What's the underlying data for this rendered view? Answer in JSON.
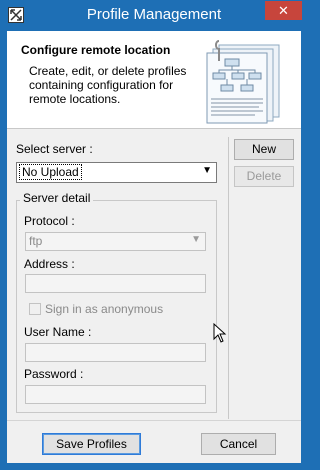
{
  "window": {
    "title": "Profile Management",
    "app_icon": "resize-arrows-icon",
    "close_icon": "close-icon"
  },
  "banner": {
    "title": "Configure remote location",
    "description": "Create, edit, or delete profiles containing configuration for remote locations.",
    "illustration": "document-flowchart-icon"
  },
  "server": {
    "label": "Select server :",
    "selected": "No Upload",
    "new_label": "New",
    "delete_label": "Delete"
  },
  "detail": {
    "group_label": "Server detail",
    "protocol_label": "Protocol :",
    "protocol_value": "ftp",
    "address_label": "Address :",
    "address_value": "",
    "anonymous_label": "Sign in as anonymous",
    "username_label": "User Name :",
    "username_value": "",
    "password_label": "Password :",
    "password_value": ""
  },
  "footer": {
    "save_label": "Save Profiles",
    "cancel_label": "Cancel"
  },
  "colors": {
    "title_bar": "#1e6fb5",
    "close_button": "#c7453c",
    "window_bg": "#f0f0f0"
  }
}
